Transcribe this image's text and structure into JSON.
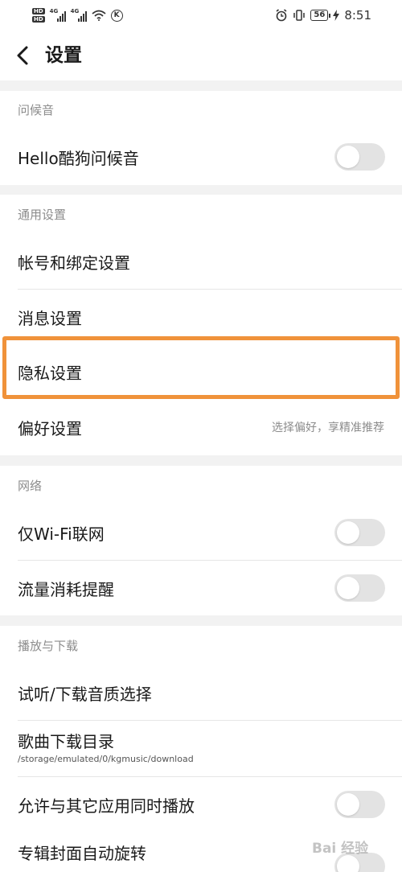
{
  "status": {
    "hd_labels": [
      "HD",
      "HD"
    ],
    "sim1_label": "4G",
    "sim2_label": "4G",
    "k_icon": "K",
    "battery": "56",
    "time": "8:51"
  },
  "nav": {
    "title": "设置"
  },
  "sections": {
    "greeting": {
      "header": "问候音",
      "items": [
        {
          "label": "Hello酷狗问候音",
          "toggle_on": false
        }
      ]
    },
    "general": {
      "header": "通用设置",
      "items": [
        {
          "label": "帐号和绑定设置"
        },
        {
          "label": "消息设置"
        },
        {
          "label": "隐私设置",
          "highlighted": true
        },
        {
          "label": "偏好设置",
          "hint": "选择偏好，享精准推荐"
        }
      ]
    },
    "network": {
      "header": "网络",
      "items": [
        {
          "label": "仅Wi-Fi联网",
          "toggle_on": false
        },
        {
          "label": "流量消耗提醒",
          "toggle_on": false
        }
      ]
    },
    "playback": {
      "header": "播放与下载",
      "items": [
        {
          "label": "试听/下载音质选择"
        },
        {
          "label": "歌曲下载目录",
          "sub": "/storage/emulated/0/kgmusic/download"
        },
        {
          "label": "允许与其它应用同时播放",
          "toggle_on": false
        },
        {
          "label": "专辑封面自动旋转",
          "toggle_on": false
        }
      ]
    }
  },
  "colors": {
    "highlight": "#f0923a",
    "toggle_off": "#e3e3e3",
    "background": "#f2f2f2"
  },
  "watermark": "Bai 经验"
}
